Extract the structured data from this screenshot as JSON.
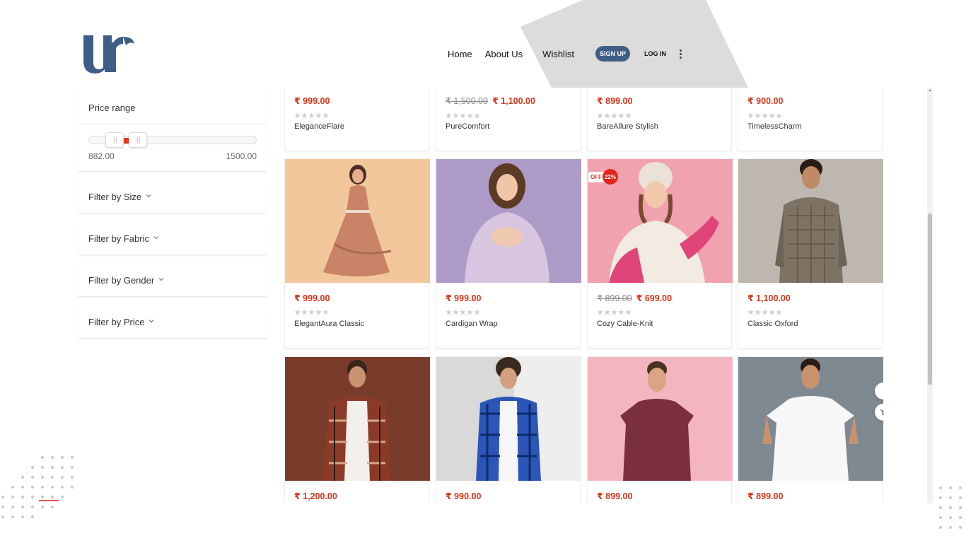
{
  "brand": {
    "logo_icon": "ur-logo-icon",
    "accent": "#3f5e86"
  },
  "nav": {
    "home": "Home",
    "about": "About Us",
    "wishlist": "Wishlist",
    "signup": "SIGN UP",
    "login": "LOG IN",
    "more_icon": "kebab-menu-icon"
  },
  "sidebar": {
    "price_range": {
      "title": "Price range",
      "min_label": "882.00",
      "max_label": "1500.00",
      "low_fraction": 0.1,
      "high_fraction": 0.24
    },
    "filters": [
      {
        "label": "Filter by Size"
      },
      {
        "label": "Filter by Fabric"
      },
      {
        "label": "Filter by Gender"
      },
      {
        "label": "Filter by Price"
      }
    ]
  },
  "products": [
    {
      "name": "EleganceFlare",
      "price": "₹ 999.00",
      "old_price": ""
    },
    {
      "name": "PureComfort",
      "price": "₹ 1,100.00",
      "old_price": "₹ 1,500.00"
    },
    {
      "name": "BareAllure Stylish",
      "price": "₹ 899.00",
      "old_price": ""
    },
    {
      "name": "TimelessCharm",
      "price": "₹ 900.00",
      "old_price": ""
    },
    {
      "name": "ElegantAura Classic",
      "price": "₹ 999.00",
      "old_price": ""
    },
    {
      "name": "Cardigan Wrap",
      "price": "₹ 999.00",
      "old_price": ""
    },
    {
      "name": "Cozy Cable-Knit",
      "price": "₹ 699.00",
      "old_price": "₹ 899.00",
      "badge_off": "OFF",
      "badge_pct": "22%"
    },
    {
      "name": "Classic Oxford",
      "price": "₹ 1,100.00",
      "old_price": ""
    },
    {
      "name": "",
      "price": "₹ 1,200.00",
      "old_price": ""
    },
    {
      "name": "",
      "price": "₹ 990.00",
      "old_price": ""
    },
    {
      "name": "",
      "price": "₹ 899.00",
      "old_price": ""
    },
    {
      "name": "",
      "price": "₹ 899.00",
      "old_price": ""
    }
  ],
  "rating_stars": 5,
  "colors": {
    "price_red": "#d8331a",
    "star_grey": "#cfcfcf"
  }
}
